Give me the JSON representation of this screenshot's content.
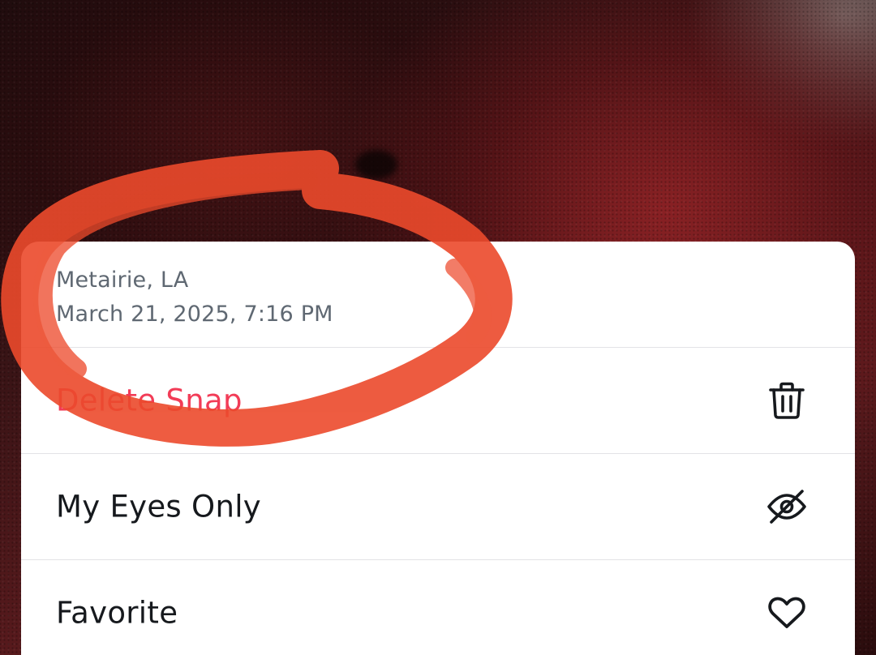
{
  "location": "Metairie, LA",
  "datetime": "March 21, 2025, 7:16 PM",
  "menu": {
    "delete_label": "Delete Snap",
    "my_eyes_only_label": "My Eyes Only",
    "favorite_label": "Favorite"
  },
  "icons": {
    "delete": "trash-icon",
    "my_eyes_only": "eye-slash-icon",
    "favorite": "heart-icon"
  },
  "colors": {
    "danger": "#f23c57",
    "text_primary": "#16191d",
    "text_secondary": "#5f6872",
    "annotation": "#ec4a2c"
  }
}
